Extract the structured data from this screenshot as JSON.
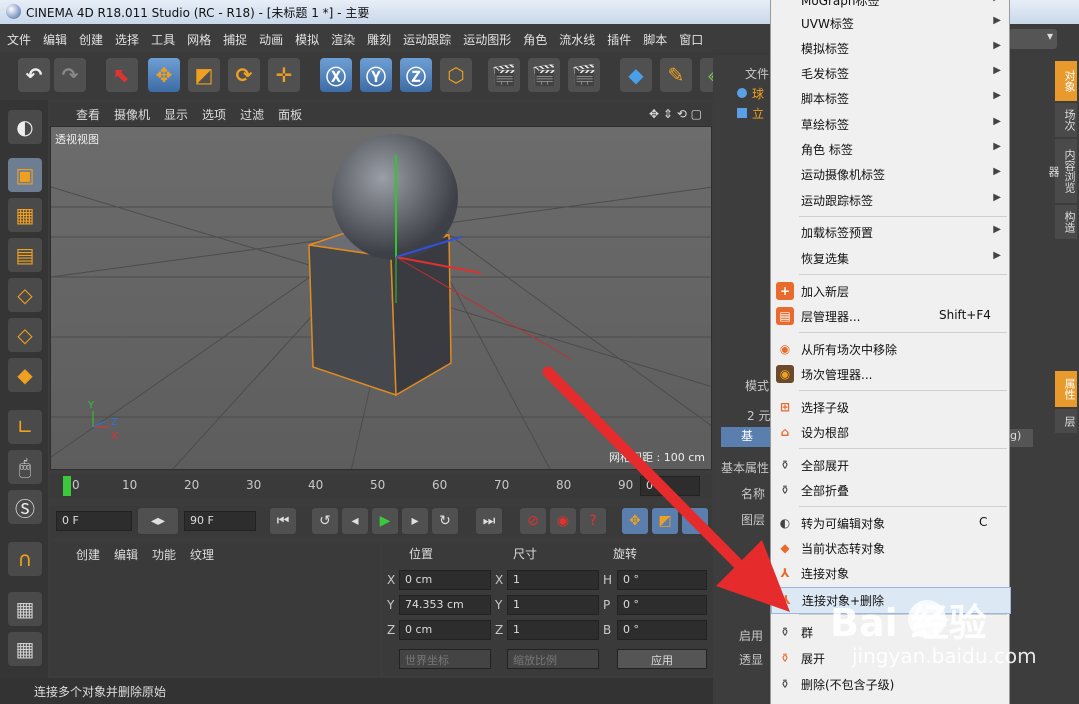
{
  "window": {
    "title": "CINEMA 4D R18.011 Studio (RC - R18) - [未标题 1 *] - 主要"
  },
  "menu": [
    "文件",
    "编辑",
    "创建",
    "选择",
    "工具",
    "网格",
    "捕捉",
    "动画",
    "模拟",
    "渲染",
    "雕刻",
    "运动跟踪",
    "运动图形",
    "角色",
    "流水线",
    "插件",
    "脚本",
    "窗口"
  ],
  "viewport": {
    "menu": [
      "查看",
      "摄像机",
      "显示",
      "选项",
      "过滤",
      "面板"
    ],
    "label": "透视视图",
    "grid_info": "网格间距 : 100 cm",
    "axis_labels": {
      "y": "Y",
      "z": "Z",
      "x": "X"
    }
  },
  "timeline": {
    "ticks": [
      "0",
      "10",
      "20",
      "30",
      "40",
      "50",
      "60",
      "70",
      "80",
      "90"
    ],
    "current_frame": "0 F"
  },
  "transport": {
    "start_field": "0 F",
    "end_field": "90 F"
  },
  "material": {
    "menu": [
      "创建",
      "编辑",
      "功能",
      "纹理"
    ]
  },
  "coords": {
    "headers": [
      "位置",
      "尺寸",
      "旋转"
    ],
    "rows": [
      {
        "a": "X",
        "pos": "0 cm",
        "b": "X",
        "size": "1",
        "c": "H",
        "rot": "0 °"
      },
      {
        "a": "Y",
        "pos": "74.353 cm",
        "b": "Y",
        "size": "1",
        "c": "P",
        "rot": "0 °"
      },
      {
        "a": "Z",
        "pos": "0 cm",
        "b": "Z",
        "size": "1",
        "c": "B",
        "rot": "0 °"
      }
    ],
    "world_coord": "世界坐标",
    "scale_mode": "缩放比例",
    "apply": "应用"
  },
  "status": "连接多个对象并删除原始",
  "object_manager": {
    "menu": "文件",
    "items": [
      {
        "name": "球",
        "color": "#5ba0e6"
      },
      {
        "name": "立",
        "color": "#5ba0e6"
      }
    ]
  },
  "attributes": {
    "title": "模式",
    "count": "2 元",
    "basic": "基本属性",
    "tab_basic": "基",
    "tag": "ng)",
    "rows": [
      "名称",
      "图层",
      "编辑",
      "显示",
      "启用",
      "透显"
    ]
  },
  "right_tabs": [
    "对象",
    "场次",
    "内容浏览器",
    "构造"
  ],
  "attr_tabs": [
    "属性",
    "层"
  ],
  "context_menu": {
    "top_partial": "MoGraph标签",
    "items": [
      {
        "label": "UVW标签",
        "arrow": true
      },
      {
        "label": "模拟标签",
        "arrow": true
      },
      {
        "label": "毛发标签",
        "arrow": true
      },
      {
        "label": "脚本标签",
        "arrow": true
      },
      {
        "label": "草绘标签",
        "arrow": true
      },
      {
        "label": "角色 标签",
        "arrow": true
      },
      {
        "label": "运动摄像机标签",
        "arrow": true
      },
      {
        "label": "运动跟踪标签",
        "arrow": true
      },
      {
        "label": "加载标签预置",
        "arrow": true
      },
      {
        "label": "恢复选集",
        "arrow": true
      },
      {
        "label": "加入新层",
        "arrow": false
      },
      {
        "label": "层管理器...",
        "shortcut": "Shift+F4"
      },
      {
        "label": "从所有场次中移除"
      },
      {
        "label": "场次管理器..."
      },
      {
        "label": "选择子级"
      },
      {
        "label": "设为根部"
      },
      {
        "label": "全部展开"
      },
      {
        "label": "全部折叠"
      },
      {
        "label": "转为可编辑对象",
        "shortcut": "C"
      },
      {
        "label": "当前状态转对象"
      },
      {
        "label": "连接对象"
      },
      {
        "label": "连接对象+删除",
        "highlight": true
      },
      {
        "label": "群"
      },
      {
        "label": "展开"
      },
      {
        "label": "删除(不包含子级)"
      }
    ]
  },
  "watermark": {
    "brand": "Bai  经验",
    "url": "jingyan.baidu.com"
  },
  "colors": {
    "accent": "#f0a020",
    "arrow": "#e52b2b",
    "highlight": "#dde8f5"
  }
}
